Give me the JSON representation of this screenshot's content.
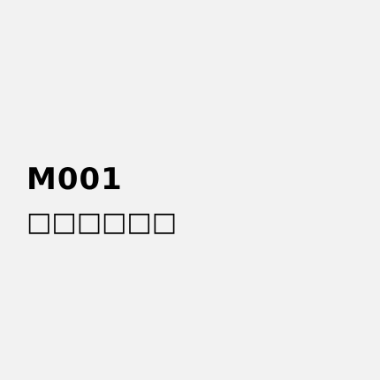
{
  "item": {
    "code": "M001",
    "name": "□□□□□□"
  }
}
